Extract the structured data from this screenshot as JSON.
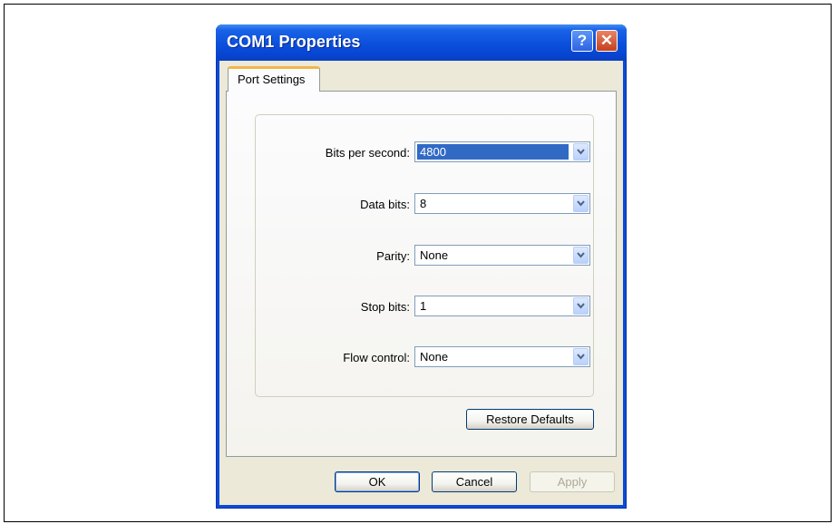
{
  "window": {
    "title": "COM1 Properties",
    "help_glyph": "?",
    "close_glyph": "✕"
  },
  "tabs": [
    {
      "label": "Port Settings",
      "active": true
    }
  ],
  "settings": [
    {
      "label": "Bits per second:",
      "value": "4800",
      "selected": true
    },
    {
      "label": "Data bits:",
      "value": "8"
    },
    {
      "label": "Parity:",
      "value": "None"
    },
    {
      "label": "Stop bits:",
      "value": "1"
    },
    {
      "label": "Flow control:",
      "value": "None"
    }
  ],
  "buttons": {
    "restore_defaults": "Restore Defaults",
    "ok": "OK",
    "cancel": "Cancel",
    "apply": "Apply"
  },
  "icons": {
    "help": "help-icon",
    "close": "close-icon",
    "dropdown": "chevron-down-icon"
  },
  "colors": {
    "titlebar": "#0a4fdc",
    "selection": "#316ac5",
    "dialog_face": "#ece9d8"
  }
}
